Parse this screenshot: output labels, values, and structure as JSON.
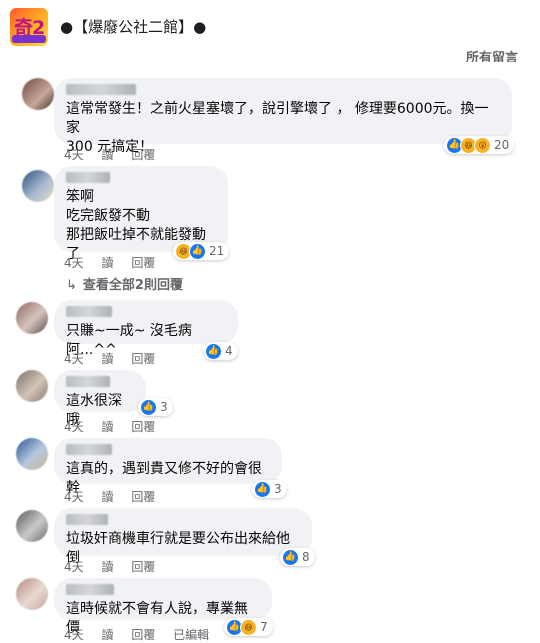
{
  "header": {
    "title": "●【爆廢公社二館】●",
    "sort_label": "所有留言",
    "colors": {
      "bubble": "#f0f2f5",
      "like": "#1877f2",
      "meta": "#65676b"
    }
  },
  "comments": [
    {
      "text": "這常常發生！之前火星塞壞了，說引擎壞了 ，  修理要6000元。換一家\n300 元搞定！",
      "time": "4天",
      "read": "讀",
      "reply": "回覆",
      "reactions": [
        "like-icon",
        "haha-icon",
        "wow-icon"
      ],
      "count": "20"
    },
    {
      "text": "笨啊\n吃完飯發不動\n那把飯吐掉不就能發動了",
      "time": "4天",
      "read": "讀",
      "reply": "回覆",
      "reactions": [
        "haha-icon",
        "like-icon"
      ],
      "count": "21",
      "view_replies": "查看全部2則回覆"
    },
    {
      "text": "只賺~一成~ 沒毛病阿...^^",
      "time": "4天",
      "read": "讀",
      "reply": "回覆",
      "reactions": [
        "like-icon"
      ],
      "count": "4"
    },
    {
      "text": "這水很深哦",
      "time": "4天",
      "read": "讀",
      "reply": "回覆",
      "reactions": [
        "like-icon"
      ],
      "count": "3"
    },
    {
      "text": "這真的，遇到貴又修不好的會很幹",
      "time": "4天",
      "read": "讀",
      "reply": "回覆",
      "reactions": [
        "like-icon"
      ],
      "count": "3"
    },
    {
      "text": "垃圾奸商機車行就是要公布出來給他倒",
      "time": "4天",
      "read": "讀",
      "reply": "回覆",
      "reactions": [
        "like-icon"
      ],
      "count": "8"
    },
    {
      "text": "這時候就不會有人說，專業無價",
      "time": "4天",
      "read": "讀",
      "reply": "回覆",
      "edited": "已編輯",
      "reactions": [
        "like-icon",
        "haha-icon"
      ],
      "count": "7"
    }
  ]
}
